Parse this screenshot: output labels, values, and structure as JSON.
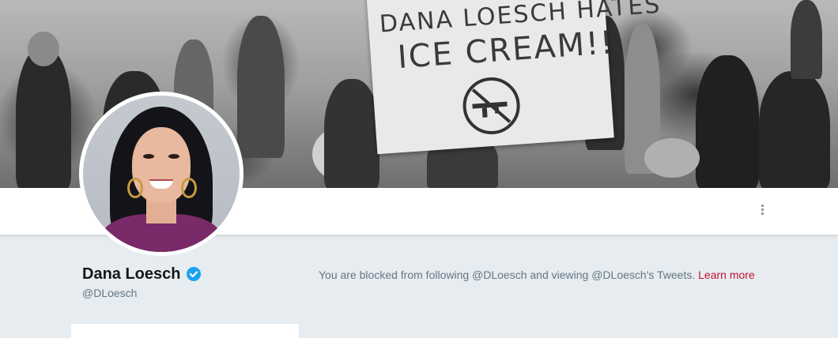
{
  "banner": {
    "sign_line1": "DANA LOESCH HATES",
    "sign_line2": "ICE CREAM!!",
    "sign_symbol": "no-gun-icon"
  },
  "profile": {
    "display_name": "Dana Loesch",
    "handle": "@DLoesch",
    "verified_icon": "verified-badge-icon",
    "verified_color": "#1da1f2"
  },
  "navbar": {
    "more_icon": "more-vertical-icon"
  },
  "blocked": {
    "message": "You are blocked from following @DLoesch and viewing @DLoesch's Tweets.",
    "learn_more": "Learn more",
    "link_color": "#c4122f"
  }
}
